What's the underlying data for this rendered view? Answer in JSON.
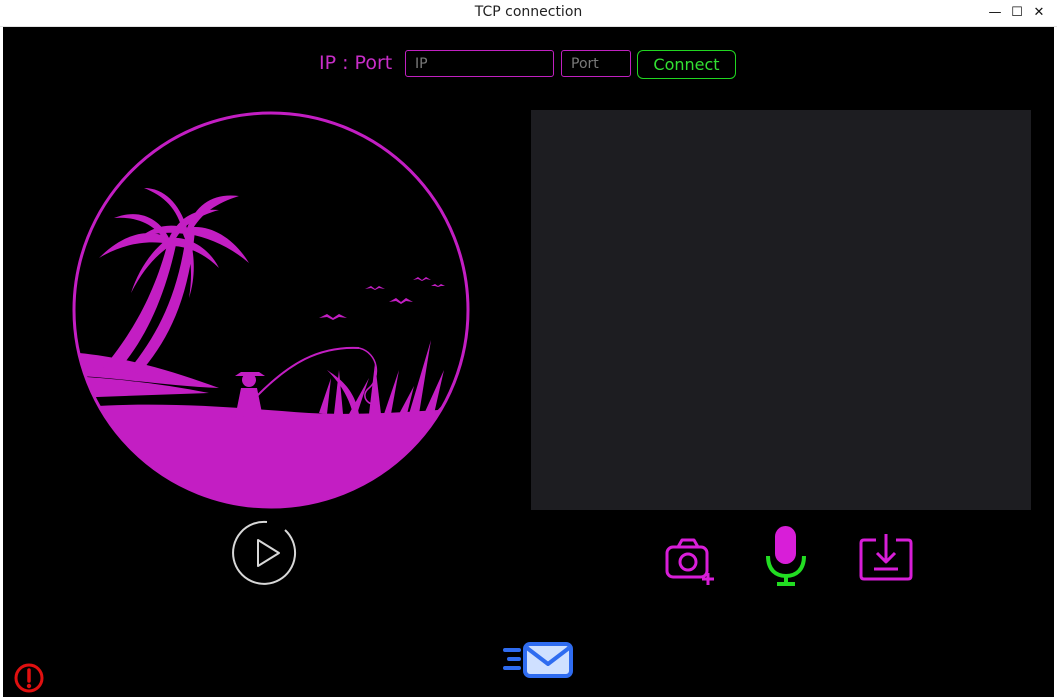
{
  "window": {
    "title": "TCP connection",
    "minimize_glyph": "—",
    "maximize_glyph": "☐",
    "close_glyph": "✕"
  },
  "connection": {
    "label": "IP : Port",
    "ip_placeholder": "IP",
    "port_placeholder": "Port",
    "ip_value": "",
    "port_value": "",
    "connect_label": "Connect"
  },
  "colors": {
    "background": "#000000",
    "accent_magenta": "#c31ec3",
    "connect_green": "#32e032",
    "mic_green": "#22dd22",
    "send_blue": "#2f6cf0",
    "video_panel": "#1d1d21",
    "alert_red": "#e01010"
  },
  "icons": {
    "play": "play-icon",
    "camera": "camera-add-icon",
    "mic": "microphone-icon",
    "download": "download-icon",
    "send": "send-mail-icon",
    "alert": "alert-circle-icon",
    "artwork": "beach-fisherman-illustration"
  }
}
